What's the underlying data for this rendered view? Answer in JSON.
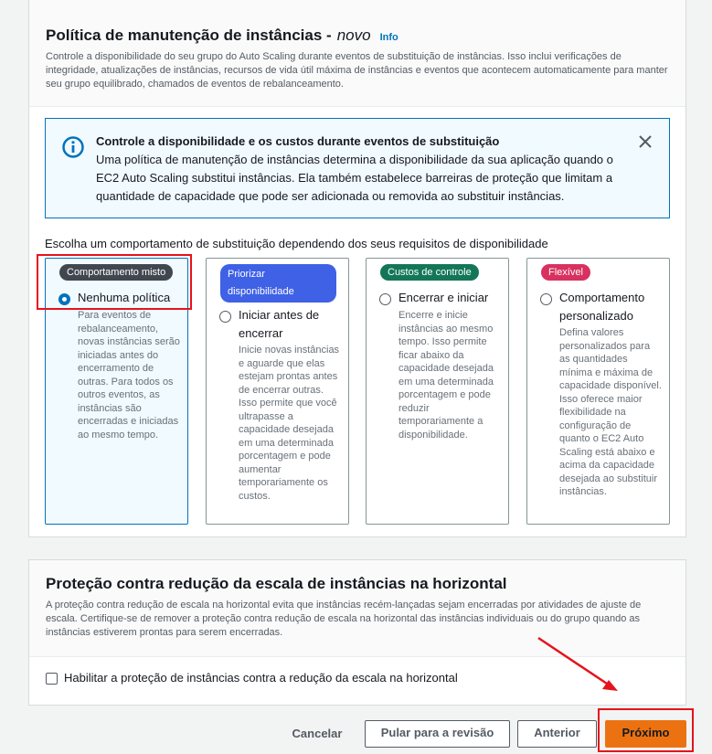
{
  "maintenance": {
    "title": "Política de manutenção de instâncias -",
    "title_new": "novo",
    "info": "Info",
    "description": "Controle a disponibilidade do seu grupo do Auto Scaling durante eventos de substituição de instâncias. Isso inclui verificações de integridade, atualizações de instâncias, recursos de vida útil máxima de instâncias e eventos que acontecem automaticamente para manter seu grupo equilibrado, chamados de eventos de rebalanceamento.",
    "alert": {
      "title": "Controle a disponibilidade e os custos durante eventos de substituição",
      "text": "Uma política de manutenção de instâncias determina a disponibilidade da sua aplicação quando o EC2 Auto Scaling substitui instâncias. Ela também estabelece barreiras de proteção que limitam a quantidade de capacidade que pode ser adicionada ou removida ao substituir instâncias."
    },
    "choose_label": "Escolha um comportamento de substituição dependendo dos seus requisitos de disponibilidade",
    "options": [
      {
        "badge": "Comportamento misto",
        "label": "Nenhuma política",
        "description": "Para eventos de rebalanceamento, novas instâncias serão iniciadas antes do encerramento de outras. Para todos os outros eventos, as instâncias são encerradas e iniciadas ao mesmo tempo.",
        "selected": true
      },
      {
        "badge": "Priorizar disponibilidade",
        "label": "Iniciar antes de encerrar",
        "description": "Inicie novas instâncias e aguarde que elas estejam prontas antes de encerrar outras. Isso permite que você ultrapasse a capacidade desejada em uma determinada porcentagem e pode aumentar temporariamente os custos.",
        "selected": false
      },
      {
        "badge": "Custos de controle",
        "label": "Encerrar e iniciar",
        "description": "Encerre e inicie instâncias ao mesmo tempo. Isso permite ficar abaixo da capacidade desejada em uma determinada porcentagem e pode reduzir temporariamente a disponibilidade.",
        "selected": false
      },
      {
        "badge": "Flexível",
        "label": "Comportamento personalizado",
        "description": "Defina valores personalizados para as quantidades mínima e máxima de capacidade disponível. Isso oferece maior flexibilidade na configuração de quanto o EC2 Auto Scaling está abaixo e acima da capacidade desejada ao substituir instâncias.",
        "selected": false
      }
    ]
  },
  "scale_in": {
    "title": "Proteção contra redução da escala de instâncias na horizontal",
    "description": "A proteção contra redução de escala na horizontal evita que instâncias recém-lançadas sejam encerradas por atividades de ajuste de escala. Certifique-se de remover a proteção contra redução de escala na horizontal das instâncias individuais ou do grupo quando as instâncias estiverem prontas para serem encerradas.",
    "checkbox_label": "Habilitar a proteção de instâncias contra a redução da escala na horizontal",
    "checked": false
  },
  "footer": {
    "cancel": "Cancelar",
    "skip": "Pular para a revisão",
    "previous": "Anterior",
    "next": "Próximo"
  },
  "colors": {
    "primary": "#ec7211",
    "link": "#0073bb",
    "annotation": "#e5131b"
  }
}
